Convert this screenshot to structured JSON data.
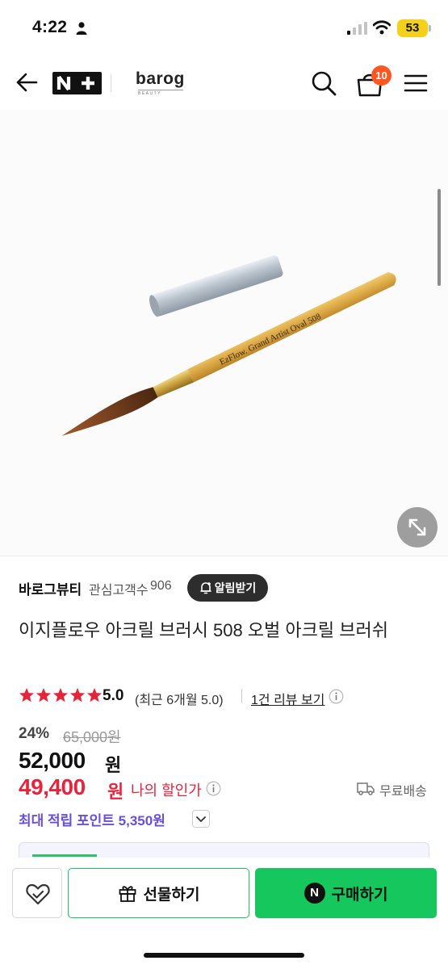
{
  "status_bar": {
    "time": "4:22",
    "battery": "53"
  },
  "header": {
    "logo_np": "N+",
    "brand_logo": "barog",
    "brand_logo_sub": "BEAUTY",
    "cart_count": "10"
  },
  "seller": {
    "name": "바로그뷰티",
    "follower_label": "관심고객수",
    "follower_count": "906",
    "notify_label": "알림받기"
  },
  "product": {
    "title": "이지플로우 아크릴 브러시 508 오벌 아크릴 브러쉬",
    "image_brush_text": "EzFlow. Grand Artist Oval 508"
  },
  "rating": {
    "value": "5.0",
    "stars": 5,
    "recent": "(최근 6개월 5.0)",
    "review_link": "1건 리뷰 보기"
  },
  "price": {
    "discount_rate": "24%",
    "original": "65,000원",
    "sale": "52,000",
    "sale_unit": "원",
    "my_price": "49,400",
    "my_unit": "원",
    "my_price_label": "나의 할인가",
    "shipping": "무료배송",
    "points": "최대 적립 포인트 5,350원"
  },
  "actions": {
    "gift_label": "선물하기",
    "npay_mark": "N",
    "buy_label": "구매하기"
  },
  "colors": {
    "accent_green": "#16c75e",
    "discount_red": "#e8243c",
    "points_purple": "#6a4fd6",
    "cart_badge": "#ff5722"
  }
}
